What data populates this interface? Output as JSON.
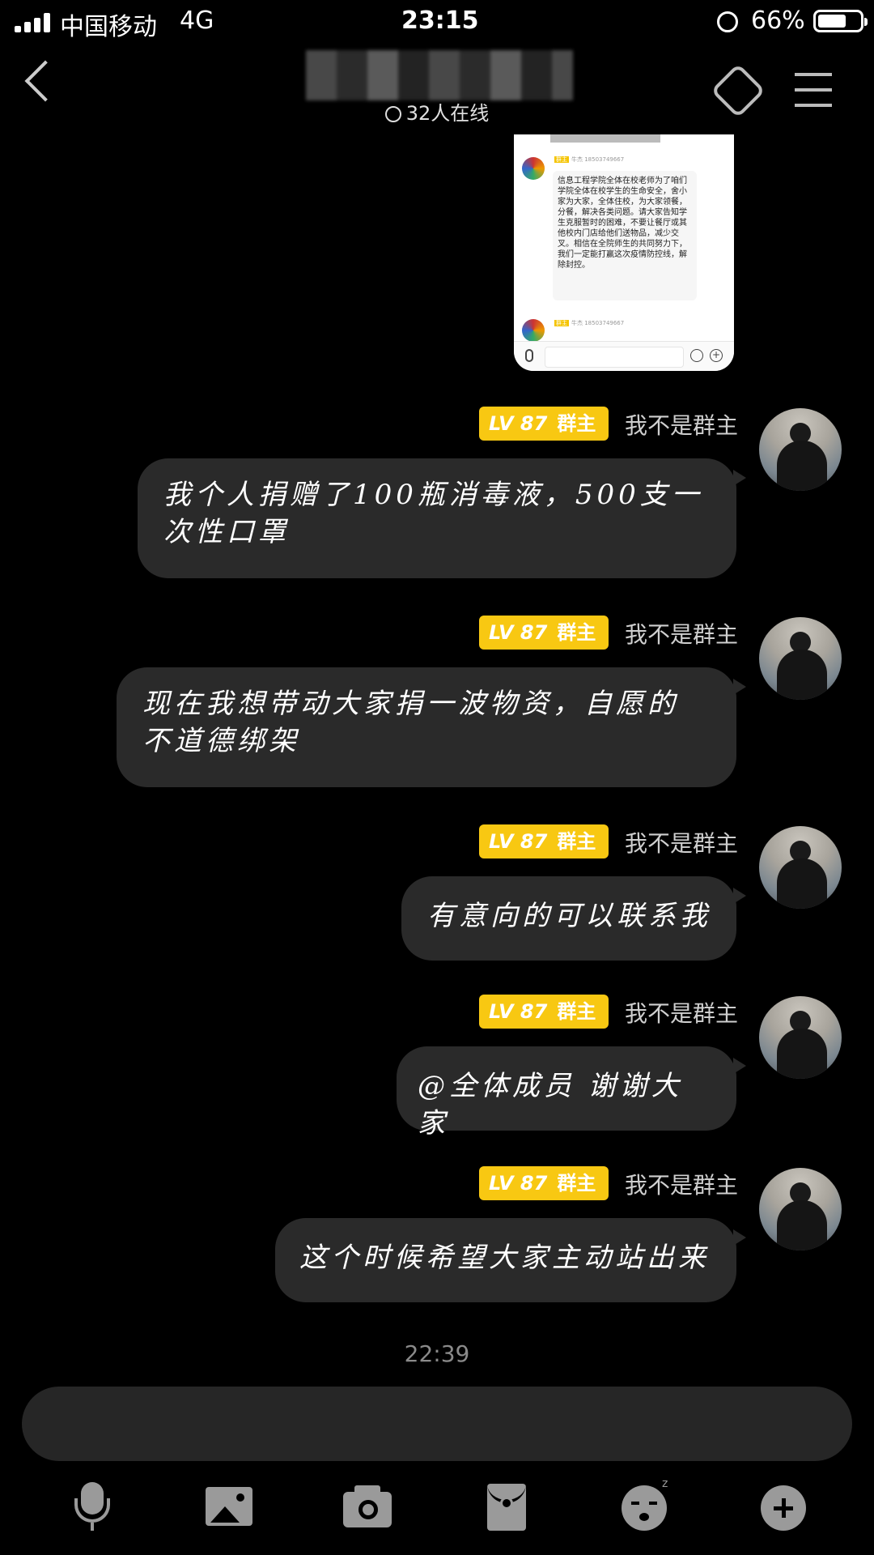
{
  "status_bar": {
    "carrier": "中国移动",
    "network": "4G",
    "time": "23:15",
    "battery": "66%"
  },
  "header": {
    "online": "32人在线"
  },
  "shared_screenshot": {
    "phone_1": "牛杰 18503749667",
    "badge": "群主",
    "message": "信息工程学院全体在校老师为了咱们学院全体在校学生的生命安全，舍小家为大家，全体住校，为大家领餐，分餐，解决各类问题。请大家告知学生克服暂时的困难，不要让餐厅或其他校内门店给他们送物品，减少交叉。相信在全院师生的共同努力下，我们一定能打赢这次疫情防控线，解除封控。",
    "phone_2": "牛杰 18503749667"
  },
  "messages": [
    {
      "level": "LV 87",
      "role": "群主",
      "sender": "我不是群主",
      "text": "我个人捐赠了100瓶消毒液，500支一次性口罩"
    },
    {
      "level": "LV 87",
      "role": "群主",
      "sender": "我不是群主",
      "text": "现在我想带动大家捐一波物资，自愿的 不道德绑架"
    },
    {
      "level": "LV 87",
      "role": "群主",
      "sender": "我不是群主",
      "text": "有意向的可以联系我"
    },
    {
      "level": "LV 87",
      "role": "群主",
      "sender": "我不是群主",
      "text": "@全体成员 谢谢大家"
    },
    {
      "level": "LV 87",
      "role": "群主",
      "sender": "我不是群主",
      "text": "这个时候希望大家主动站出来"
    }
  ],
  "timestamp": "22:39",
  "toolbar": {
    "icons": [
      "microphone-icon",
      "image-icon",
      "camera-icon",
      "red-packet-icon",
      "emoji-icon",
      "plus-icon"
    ]
  }
}
